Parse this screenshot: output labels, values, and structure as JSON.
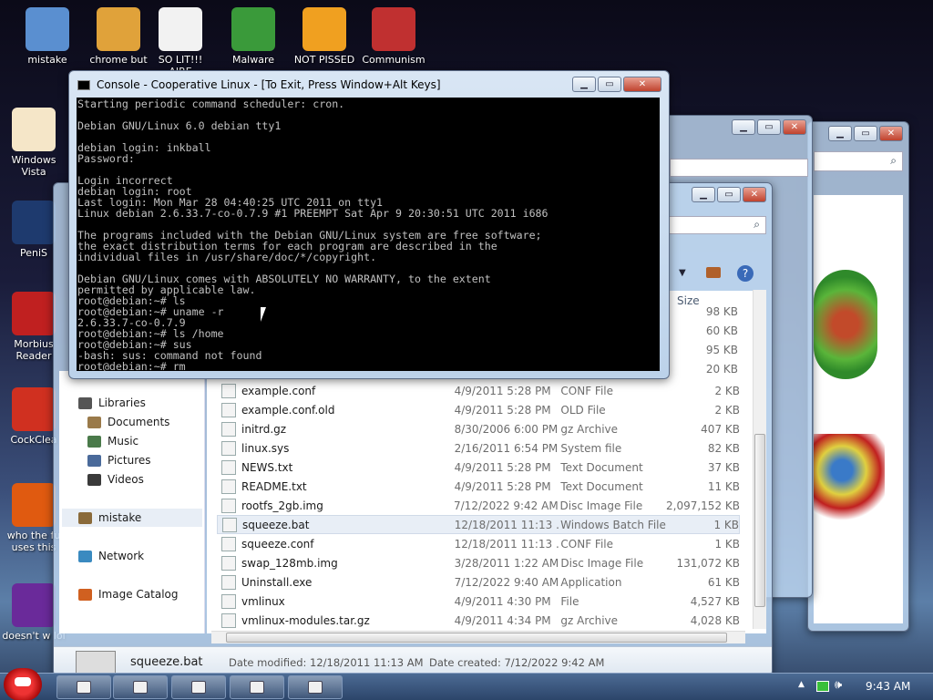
{
  "desktop": {
    "top_icons": [
      {
        "label": "mistake",
        "icon": "computer-icon",
        "color": "#5a8fd0"
      },
      {
        "label": "chrome but",
        "icon": "chrome-icon",
        "color": "#e0a23a"
      },
      {
        "label": "SO LIT!!! AIRE",
        "icon": "solitaire-icon",
        "color": "#f2f2f2"
      },
      {
        "label": "Malware",
        "icon": "shield-icon",
        "color": "#3a9a3a"
      },
      {
        "label": "NOT PISSED",
        "icon": "bad-piggies-icon",
        "color": "#f0a020"
      },
      {
        "label": "Communism",
        "icon": "emblem-icon",
        "color": "#c03030"
      }
    ],
    "left_icons": [
      {
        "label": "Windows Vista",
        "icon": "egg-icon",
        "color": "#f5e6c8"
      },
      {
        "label": "PeniS",
        "icon": "photoshop-icon",
        "color": "#1e3a6e"
      },
      {
        "label": "Morbius Reader",
        "icon": "pdf-icon",
        "color": "#c02020"
      },
      {
        "label": "CockClea",
        "icon": "ccleaner-icon",
        "color": "#d03020"
      },
      {
        "label": "who the fu uses this",
        "icon": "winamp-icon",
        "color": "#e05a10"
      },
      {
        "label": "doesn't w lol",
        "icon": "yahoo-icon",
        "color": "#6a2a9a"
      }
    ]
  },
  "console": {
    "title": "Console - Cooperative Linux - [To Exit, Press Window+Alt Keys]",
    "lines": [
      "Starting periodic command scheduler: cron.",
      "",
      "Debian GNU/Linux 6.0 debian tty1",
      "",
      "debian login: inkball",
      "Password:",
      "",
      "Login incorrect",
      "debian login: root",
      "Last login: Mon Mar 28 04:40:25 UTC 2011 on tty1",
      "Linux debian 2.6.33.7-co-0.7.9 #1 PREEMPT Sat Apr 9 20:30:51 UTC 2011 i686",
      "",
      "The programs included with the Debian GNU/Linux system are free software;",
      "the exact distribution terms for each program are described in the",
      "individual files in /usr/share/doc/*/copyright.",
      "",
      "Debian GNU/Linux comes with ABSOLUTELY NO WARRANTY, to the extent",
      "permitted by applicable law.",
      "root@debian:~# ls",
      "root@debian:~# uname -r",
      "2.6.33.7-co-0.7.9",
      "root@debian:~# ls /home",
      "root@debian:~# sus",
      "-bash: sus: command not found",
      "root@debian:~# rm_"
    ]
  },
  "explorer": {
    "column_size": "Size",
    "nav": [
      {
        "label": "Libraries",
        "icon": "libraries-icon",
        "color": "#555"
      },
      {
        "label": "Documents",
        "icon": "documents-icon",
        "color": "#9a7a4a"
      },
      {
        "label": "Music",
        "icon": "music-icon",
        "color": "#4a7a4a"
      },
      {
        "label": "Pictures",
        "icon": "pictures-icon",
        "color": "#4a6a9a"
      },
      {
        "label": "Videos",
        "icon": "videos-icon",
        "color": "#3a3a3a"
      },
      {
        "label": "mistake",
        "icon": "homegroup-icon",
        "color": "#8a6a3a"
      },
      {
        "label": "Network",
        "icon": "network-icon",
        "color": "#3a8ac0"
      },
      {
        "label": "Image Catalog",
        "icon": "image-catalog-icon",
        "color": "#d06020"
      }
    ],
    "partial_sizes": [
      "98 KB",
      "60 KB",
      "95 KB",
      "20 KB"
    ],
    "files": [
      {
        "name": "example.conf",
        "date": "4/9/2011 5:28 PM",
        "type": "CONF File",
        "size": "2 KB"
      },
      {
        "name": "example.conf.old",
        "date": "4/9/2011 5:28 PM",
        "type": "OLD File",
        "size": "2 KB"
      },
      {
        "name": "initrd.gz",
        "date": "8/30/2006 6:00 PM",
        "type": "gz Archive",
        "size": "407 KB"
      },
      {
        "name": "linux.sys",
        "date": "2/16/2011 6:54 PM",
        "type": "System file",
        "size": "82 KB"
      },
      {
        "name": "NEWS.txt",
        "date": "4/9/2011 5:28 PM",
        "type": "Text Document",
        "size": "37 KB"
      },
      {
        "name": "README.txt",
        "date": "4/9/2011 5:28 PM",
        "type": "Text Document",
        "size": "11 KB"
      },
      {
        "name": "rootfs_2gb.img",
        "date": "7/12/2022 9:42 AM",
        "type": "Disc Image File",
        "size": "2,097,152 KB"
      },
      {
        "name": "squeeze.bat",
        "date": "12/18/2011 11:13 ...",
        "type": "Windows Batch File",
        "size": "1 KB"
      },
      {
        "name": "squeeze.conf",
        "date": "12/18/2011 11:13 ...",
        "type": "CONF File",
        "size": "1 KB"
      },
      {
        "name": "swap_128mb.img",
        "date": "3/28/2011 1:22 AM",
        "type": "Disc Image File",
        "size": "131,072 KB"
      },
      {
        "name": "Uninstall.exe",
        "date": "7/12/2022 9:40 AM",
        "type": "Application",
        "size": "61 KB"
      },
      {
        "name": "vmlinux",
        "date": "4/9/2011 4:30 PM",
        "type": "File",
        "size": "4,527 KB"
      },
      {
        "name": "vmlinux-modules.tar.gz",
        "date": "4/9/2011 4:34 PM",
        "type": "gz Archive",
        "size": "4,028 KB"
      }
    ],
    "status": {
      "filename": "squeeze.bat",
      "modified": "Date modified: 12/18/2011 11:13 AM",
      "created": "Date created: 7/12/2022 9:42 AM"
    }
  },
  "taskbar": {
    "clock": "9:43 AM",
    "buttons": [
      {
        "icon": "explorer-icon"
      },
      {
        "icon": "chrome-icon"
      },
      {
        "icon": "app-icon"
      },
      {
        "icon": "notepad-icon"
      },
      {
        "icon": "console-icon"
      }
    ]
  }
}
